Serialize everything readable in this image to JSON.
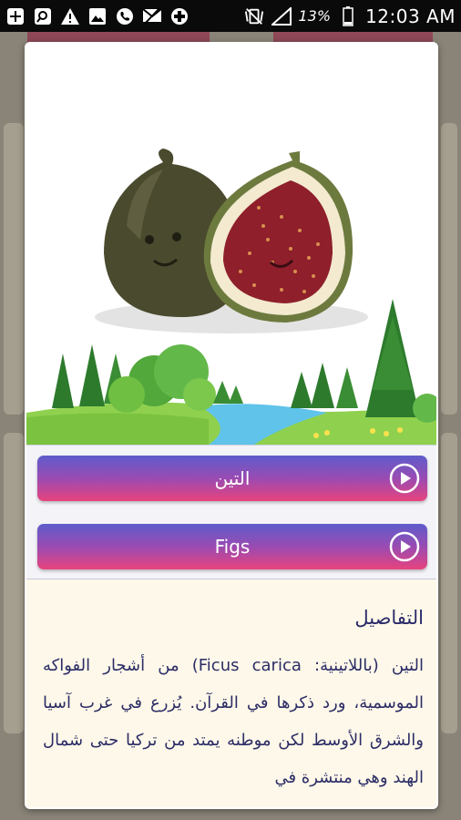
{
  "status_bar": {
    "battery_text": "13%",
    "time": "12:03 AM",
    "icons": [
      "plus-icon",
      "search-app-icon",
      "warning-icon",
      "image-icon",
      "phone-icon",
      "sms-blocked-icon",
      "medical-plus-icon"
    ],
    "right_icons": [
      "vibrate-mute-icon",
      "signal-icon",
      "battery-icon"
    ]
  },
  "dialog": {
    "fruit_name_ar": "التين",
    "fruit_name_en": "Figs",
    "details_title": "التفاصيل",
    "details_text": "التين (باللاتينية: Ficus carica) من أشجار الفواكه الموسمية، ورد ذكرها في القرآن. يُزرع في غرب آسيا والشرق الأوسط لكن موطنه يمتد من تركيا حتى شمال الهند وهي منتشرة في"
  },
  "colors": {
    "button_top": "#5e5ccc",
    "button_bottom": "#e8437d",
    "details_bg": "#fdf8e9",
    "text_color": "#2c2c66"
  }
}
